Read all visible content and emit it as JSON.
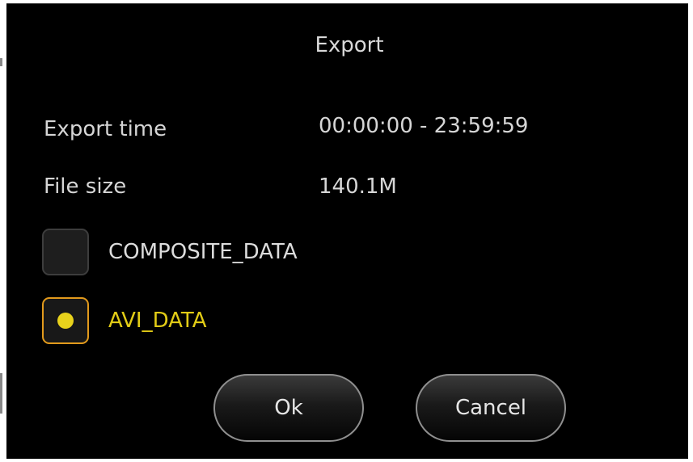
{
  "dialog": {
    "title": "Export"
  },
  "fields": {
    "export_time_label": "Export time",
    "export_time_value": "00:00:00 - 23:59:59",
    "file_size_label": "File size",
    "file_size_value": "140.1M"
  },
  "options": [
    {
      "label": "COMPOSITE_DATA",
      "checked": false
    },
    {
      "label": "AVI_DATA",
      "checked": true
    }
  ],
  "buttons": {
    "ok_label": "Ok",
    "cancel_label": "Cancel"
  },
  "colors": {
    "background": "#000000",
    "text": "#d6d6d6",
    "selected_text": "#e2cc16",
    "selected_border": "#e29a1c",
    "selected_dot": "#e8d21c"
  }
}
